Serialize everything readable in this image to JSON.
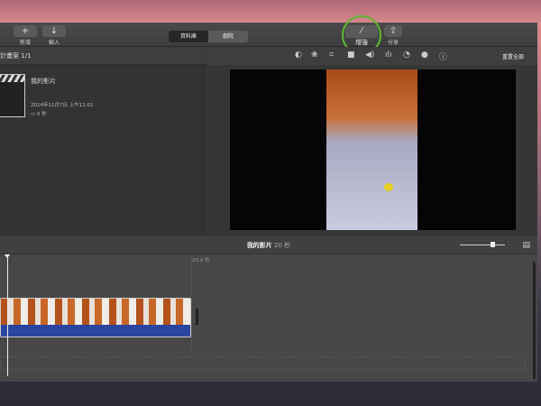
{
  "toolbar": {
    "new_label": "新增",
    "import_label": "輸入",
    "library_tab": "資料庫",
    "theater_tab": "劇院",
    "enhance_label": "增強",
    "share_label": "分享"
  },
  "library": {
    "header": "計畫案",
    "count": "1/1",
    "project": {
      "title": "我的影片",
      "date": "2014年11月7日 上午11:01",
      "duration": "0 秒"
    }
  },
  "viewer": {
    "tools": [
      "color-balance-icon",
      "color-correction-icon",
      "crop-icon",
      "stabilization-icon",
      "volume-icon",
      "noise-reduction-icon",
      "speed-icon",
      "filter-icon",
      "info-icon"
    ],
    "reset_all": "重置全部"
  },
  "timeline": {
    "title": "我的影片",
    "duration": "20 秒",
    "end_marker": "20.9 秒",
    "zoom_level": 0.7
  },
  "colors": {
    "highlight": "#5fb832",
    "audio": "#2a45a0"
  }
}
